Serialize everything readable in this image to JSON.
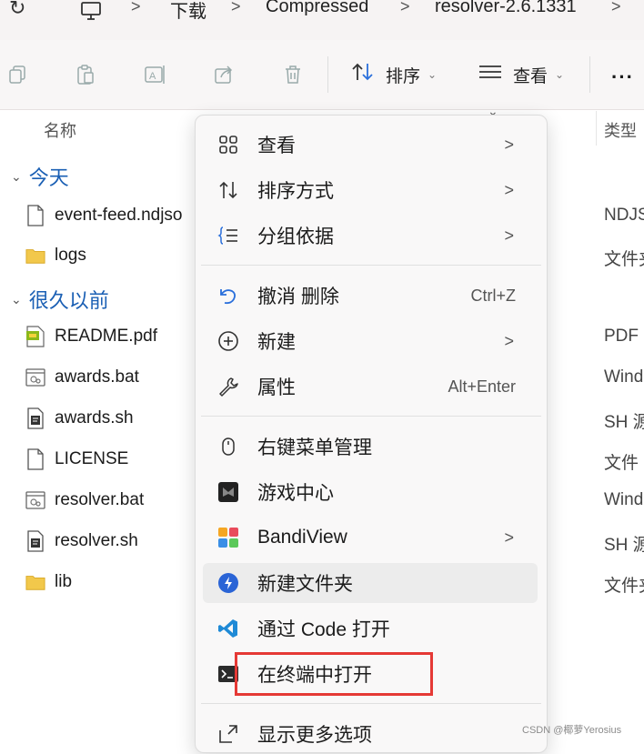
{
  "address": {
    "crumbs": [
      "下载",
      "Compressed",
      "resolver-2.6.1331"
    ],
    "separator": ">"
  },
  "toolbar": {
    "sort_label": "排序",
    "view_label": "查看",
    "more_label": "···"
  },
  "columns": {
    "name": "名称",
    "type": "类型"
  },
  "groups": {
    "today": "今天",
    "long_ago": "很久以前"
  },
  "files": [
    {
      "name": "event-feed.ndjso",
      "type": "NDJS",
      "icon": "file-icon"
    },
    {
      "name": "logs",
      "type": "文件夹",
      "icon": "folder-icon"
    },
    {
      "name": "README.pdf",
      "type": "PDF",
      "icon": "pdf-icon"
    },
    {
      "name": "awards.bat",
      "type": "Wind",
      "icon": "bat-icon"
    },
    {
      "name": "awards.sh",
      "type": "SH 源",
      "icon": "sh-icon"
    },
    {
      "name": "LICENSE",
      "type": "文件",
      "icon": "file-icon"
    },
    {
      "name": "resolver.bat",
      "type": "Wind",
      "icon": "bat-icon"
    },
    {
      "name": "resolver.sh",
      "type": "SH 源",
      "icon": "sh-icon"
    },
    {
      "name": "lib",
      "type": "文件夹",
      "icon": "folder-icon"
    }
  ],
  "context_menu": {
    "items": [
      {
        "label": "查看",
        "icon": "grid-view-icon",
        "submenu": true
      },
      {
        "label": "排序方式",
        "icon": "sort-icon",
        "submenu": true
      },
      {
        "label": "分组依据",
        "icon": "group-list-icon",
        "submenu": true
      },
      {
        "label": "撤消 删除",
        "icon": "undo-icon",
        "shortcut": "Ctrl+Z"
      },
      {
        "label": "新建",
        "icon": "plus-circle-icon",
        "submenu": true
      },
      {
        "label": "属性",
        "icon": "wrench-icon",
        "shortcut": "Alt+Enter"
      },
      {
        "label": "右键菜单管理",
        "icon": "mouse-icon"
      },
      {
        "label": "游戏中心",
        "icon": "game-center-icon"
      },
      {
        "label": "BandiView",
        "icon": "bandiview-icon",
        "submenu": true
      },
      {
        "label": "新建文件夹",
        "icon": "new-folder-icon"
      },
      {
        "label": "通过 Code 打开",
        "icon": "vscode-icon"
      },
      {
        "label": "在终端中打开",
        "icon": "terminal-icon"
      },
      {
        "label": "显示更多选项",
        "icon": "expand-icon"
      }
    ],
    "submenu_arrow": ">"
  },
  "watermark": "CSDN @椰萝Yerosius",
  "colors": {
    "highlight": "#e53935",
    "group_text": "#1a5fb4",
    "folder": "#f2c84b"
  }
}
